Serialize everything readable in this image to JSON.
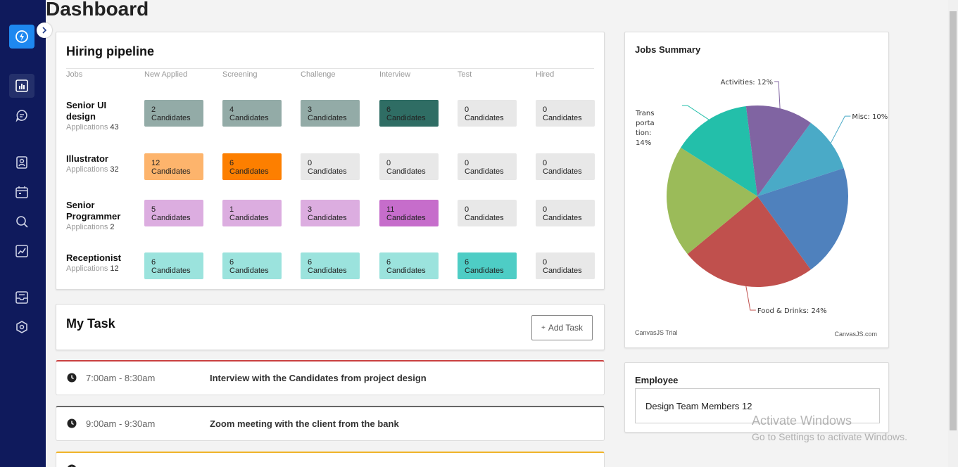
{
  "page": {
    "title": "Dashboard"
  },
  "sidebar": {
    "logo_icon": "bolt-icon",
    "items": [
      {
        "icon": "bar-chart-icon",
        "active": true
      },
      {
        "icon": "chat-icon",
        "active": false
      },
      {
        "icon": "contact-icon",
        "active": false
      },
      {
        "icon": "calendar-icon",
        "active": false
      },
      {
        "icon": "search-icon",
        "active": false
      },
      {
        "icon": "trend-chart-icon",
        "active": false
      },
      {
        "icon": "inbox-icon",
        "active": false
      },
      {
        "icon": "settings-icon",
        "active": false
      }
    ]
  },
  "pipeline": {
    "title": "Hiring pipeline",
    "columns": [
      "Jobs",
      "New Applied",
      "Screening",
      "Challenge",
      "Interview",
      "Test",
      "Hired"
    ],
    "applications_label": "Applications",
    "rows": [
      {
        "job": "Senior UI design",
        "applications": "43",
        "cells": [
          {
            "count": "2",
            "label": "Candidates",
            "color": "#93aba7"
          },
          {
            "count": "4",
            "label": "Candidates",
            "color": "#93aba7"
          },
          {
            "count": "3",
            "label": "Candidates",
            "color": "#93aba7"
          },
          {
            "count": "6",
            "label": "Candidates",
            "color": "#2f6d64"
          },
          {
            "count": "0",
            "label": "Candidates",
            "color": "#e8e8e8"
          },
          {
            "count": "0",
            "label": "Candidates",
            "color": "#e8e8e8"
          }
        ]
      },
      {
        "job": "Illustrator",
        "applications": "32",
        "cells": [
          {
            "count": "12",
            "label": "Candidates",
            "color": "#fdb46c"
          },
          {
            "count": "6",
            "label": "Candidates",
            "color": "#fd7f00"
          },
          {
            "count": "0",
            "label": "Candidates",
            "color": "#e8e8e8"
          },
          {
            "count": "0",
            "label": "Candidates",
            "color": "#e8e8e8"
          },
          {
            "count": "0",
            "label": "Candidates",
            "color": "#e8e8e8"
          },
          {
            "count": "0",
            "label": "Candidates",
            "color": "#e8e8e8"
          }
        ]
      },
      {
        "job": "Senior Programmer",
        "applications": "2",
        "cells": [
          {
            "count": "5",
            "label": "Candidates",
            "color": "#dcade0"
          },
          {
            "count": "1",
            "label": "Candidates",
            "color": "#dcade0"
          },
          {
            "count": "3",
            "label": "Candidates",
            "color": "#dcade0"
          },
          {
            "count": "11",
            "label": "Candidates",
            "color": "#c66dcb"
          },
          {
            "count": "0",
            "label": "Candidates",
            "color": "#e8e8e8"
          },
          {
            "count": "0",
            "label": "Candidates",
            "color": "#e8e8e8"
          }
        ]
      },
      {
        "job": "Receptionist",
        "applications": "12",
        "cells": [
          {
            "count": "6",
            "label": "Candidates",
            "color": "#9be3dd"
          },
          {
            "count": "6",
            "label": "Candidates",
            "color": "#9be3dd"
          },
          {
            "count": "6",
            "label": "Candidates",
            "color": "#9be3dd"
          },
          {
            "count": "6",
            "label": "Candidates",
            "color": "#9be3dd"
          },
          {
            "count": "6",
            "label": "Candidates",
            "color": "#4ecdc5"
          },
          {
            "count": "0",
            "label": "Candidates",
            "color": "#e8e8e8"
          }
        ]
      }
    ]
  },
  "mytask": {
    "title": "My Task",
    "add_label": "Add Task",
    "add_icon": "+",
    "tasks": [
      {
        "time": "7:00am - 8:30am",
        "title": "Interview with the Candidates from project design",
        "color": "#c94040"
      },
      {
        "time": "9:00am - 9:30am",
        "title": "Zoom meeting with the client from the bank",
        "color": "#666666"
      },
      {
        "time": "",
        "title": "",
        "color": "#f0b429"
      }
    ]
  },
  "jobs_summary": {
    "title": "Jobs Summary",
    "trial_text": "CanvasJS Trial",
    "credit_text": "CanvasJS.com"
  },
  "chart_data": {
    "type": "pie",
    "title": "Jobs Summary",
    "slices": [
      {
        "label": "Misc",
        "value": 10,
        "color": "#4aaac7"
      },
      {
        "label": "",
        "value": 20,
        "color": "#4f81bd"
      },
      {
        "label": "Food & Drinks",
        "value": 24,
        "color": "#c0504d"
      },
      {
        "label": "",
        "value": 20,
        "color": "#9bbb59"
      },
      {
        "label": "Transportation",
        "value": 14,
        "color": "#23bfaa"
      },
      {
        "label": "Activities",
        "value": 12,
        "color": "#8064a2"
      }
    ],
    "labels_shown": [
      {
        "text": "Activities: 12%"
      },
      {
        "text": "Misc: 10%"
      },
      {
        "text": "Trans porta tion: 14%"
      },
      {
        "text": "Food & Drinks: 24%"
      }
    ]
  },
  "employee": {
    "title": "Employee",
    "item": "Design Team Members 12"
  },
  "watermark": {
    "line1": "Activate Windows",
    "line2": "Go to Settings to activate Windows."
  }
}
